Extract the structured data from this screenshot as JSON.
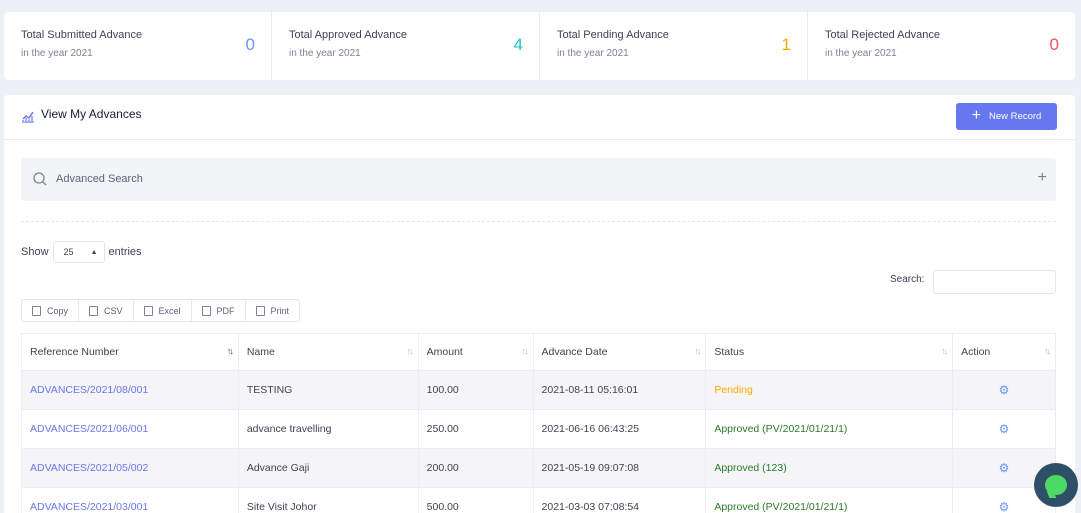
{
  "stats": [
    {
      "title": "Total Submitted Advance",
      "sub": "in the year 2021",
      "value": "0",
      "color": "#6993ff"
    },
    {
      "title": "Total Approved Advance",
      "sub": "in the year 2021",
      "value": "4",
      "color": "#1bc5bd"
    },
    {
      "title": "Total Pending Advance",
      "sub": "in the year 2021",
      "value": "1",
      "color": "#ffa800"
    },
    {
      "title": "Total Rejected Advance",
      "sub": "in the year 2021",
      "value": "0",
      "color": "#f64e60"
    }
  ],
  "card": {
    "title": "View My Advances",
    "title_icon": "chart-line-icon",
    "new_button": "New Record"
  },
  "advanced_search": {
    "label": "Advanced Search",
    "icon": "search-icon"
  },
  "length": {
    "show": "Show",
    "value": "25",
    "entries": "entries"
  },
  "search": {
    "label": "Search:",
    "value": ""
  },
  "export_buttons": [
    {
      "label": "Copy",
      "icon": "copy-icon"
    },
    {
      "label": "CSV",
      "icon": "csv-file-icon"
    },
    {
      "label": "Excel",
      "icon": "excel-file-icon"
    },
    {
      "label": "PDF",
      "icon": "pdf-file-icon"
    },
    {
      "label": "Print",
      "icon": "print-icon"
    }
  ],
  "table": {
    "headers": [
      "Reference Number",
      "Name",
      "Amount",
      "Advance Date",
      "Status",
      "Action"
    ],
    "rows": [
      {
        "ref": "ADVANCES/2021/08/001",
        "name": "TESTING",
        "amount": "100.00",
        "date": "2021-08-11 05:16:01",
        "status": "Pending"
      },
      {
        "ref": "ADVANCES/2021/06/001",
        "name": "advance travelling",
        "amount": "250.00",
        "date": "2021-06-16 06:43:25",
        "status": "Approved (PV/2021/01/21/1)"
      },
      {
        "ref": "ADVANCES/2021/05/002",
        "name": "Advance Gaji",
        "amount": "200.00",
        "date": "2021-05-19 09:07:08",
        "status": "Approved (123)"
      },
      {
        "ref": "ADVANCES/2021/03/001",
        "name": "Site Visit Johor",
        "amount": "500.00",
        "date": "2021-03-03 07:08:54",
        "status": "Approved (PV/2021/01/21/1)"
      }
    ]
  },
  "colors": {
    "accent": "#6777ef",
    "pending": "#ffa800",
    "approved": "#2a7a2a"
  }
}
